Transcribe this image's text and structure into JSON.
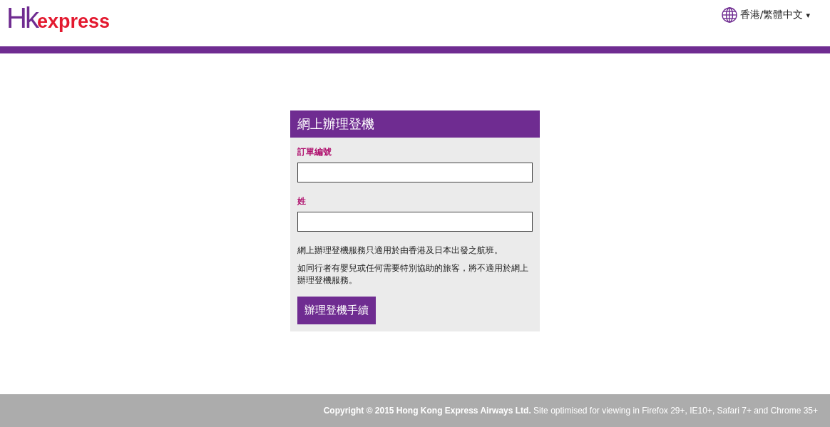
{
  "header": {
    "logo": {
      "mark": "Hk",
      "word": "express"
    },
    "language": {
      "label": "香港/繁體中文",
      "caret": "▾"
    }
  },
  "form": {
    "title": "網上辦理登機",
    "fields": [
      {
        "label": "訂單編號"
      },
      {
        "label": "姓"
      }
    ],
    "notes": [
      "網上辦理登機服務只適用於由香港及日本出發之航班。",
      "如同行者有嬰兒或任何需要特別協助的旅客，將不適用於網上辦理登機服務。"
    ],
    "submit": "辦理登機手續"
  },
  "footer": {
    "text": "**Copyright © 2015 Hong Kong Express Airways Ltd.** Site optimised for viewing in Firefox 29+, IE10+, Safari 7+ and Chrome 35+"
  }
}
